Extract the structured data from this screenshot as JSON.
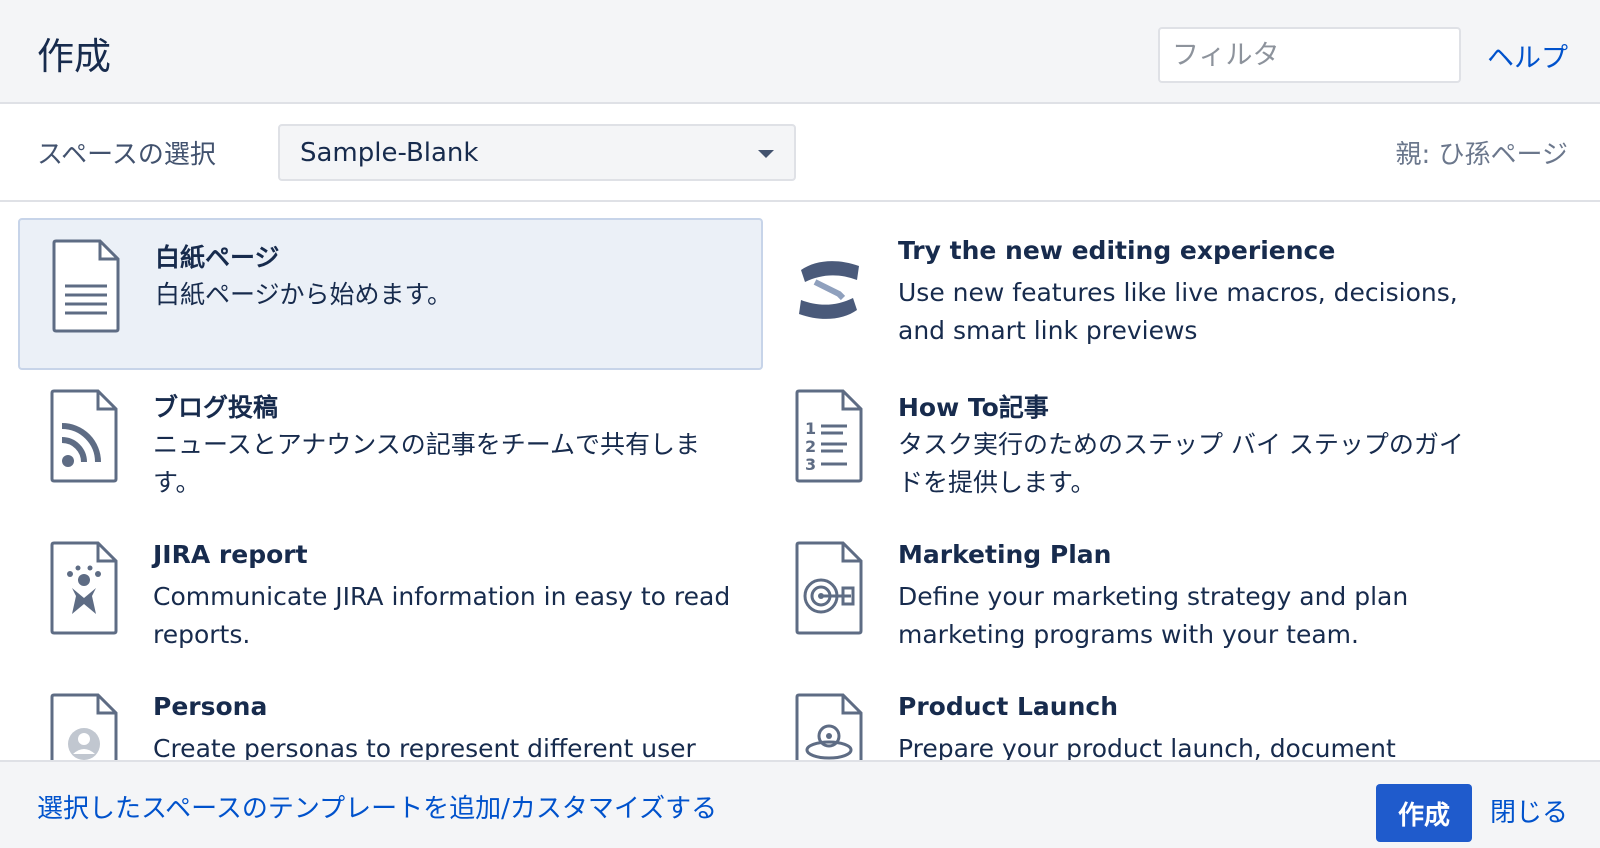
{
  "header": {
    "title": "作成",
    "filter_placeholder": "フィルタ",
    "help_label": "ヘルプ"
  },
  "space_bar": {
    "label": "スペースの選択",
    "selected_space": "Sample-Blank",
    "parent_label": "親: ひ孫ページ"
  },
  "templates": [
    {
      "title": "白紙ページ",
      "description": "白紙ページから始めます。",
      "icon": "blank-page-icon",
      "selected": true
    },
    {
      "title": "Try the new editing experience",
      "description": "Use new features like live macros, decisions, and smart link previews",
      "icon": "confluence-logo-icon",
      "selected": false
    },
    {
      "title": "ブログ投稿",
      "description": "ニュースとアナウンスの記事をチームで共有します。",
      "icon": "rss-icon",
      "selected": false
    },
    {
      "title": "How To記事",
      "description": "タスク実行のためのステップ バイ ステップのガイドを提供します。",
      "icon": "numbered-list-icon",
      "selected": false
    },
    {
      "title": "JIRA report",
      "description": "Communicate JIRA information in easy to read reports.",
      "icon": "jira-icon",
      "selected": false
    },
    {
      "title": "Marketing Plan",
      "description": "Define your marketing strategy and plan marketing programs with your team.",
      "icon": "target-icon",
      "selected": false
    },
    {
      "title": "Persona",
      "description": "Create personas to represent different user",
      "icon": "person-icon",
      "selected": false
    },
    {
      "title": "Product Launch",
      "description": "Prepare your product launch, document",
      "icon": "gears-icon",
      "selected": false
    }
  ],
  "footer": {
    "customize_link": "選択したスペースのテンプレートを追加/カスタマイズする",
    "create_button": "作成",
    "close_link": "閉じる"
  },
  "colors": {
    "accent": "#0052cc",
    "primary_button": "#1f5bcc",
    "selected_card_bg": "#ebf0f7"
  }
}
